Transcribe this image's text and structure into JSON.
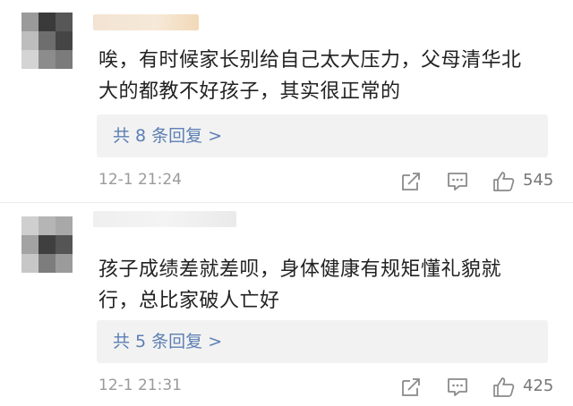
{
  "comments": [
    {
      "text_line1": "唉，有时候家长别给自己太大压力，父母清华北",
      "text_line2": "大的都教不好孩子，其实很正常的",
      "replies_label": "共 8 条回复 >",
      "time": "12-1 21:24",
      "like_count": "545",
      "icons": [
        "share-icon",
        "comment-icon",
        "like-icon"
      ]
    },
    {
      "text_line1": "孩子成绩差就差呗，身体健康有规矩懂礼貌就",
      "text_line2": "行，总比家破人亡好",
      "replies_label": "共 5 条回复 >",
      "time": "12-1 21:31",
      "like_count": "425",
      "icons": [
        "share-icon",
        "comment-icon",
        "like-icon"
      ]
    }
  ],
  "colors": {
    "reply_link": "#5b7fb4",
    "reply_box": "#f2f2f2",
    "meta_text": "#9a9a9a",
    "body_text": "#222222"
  }
}
